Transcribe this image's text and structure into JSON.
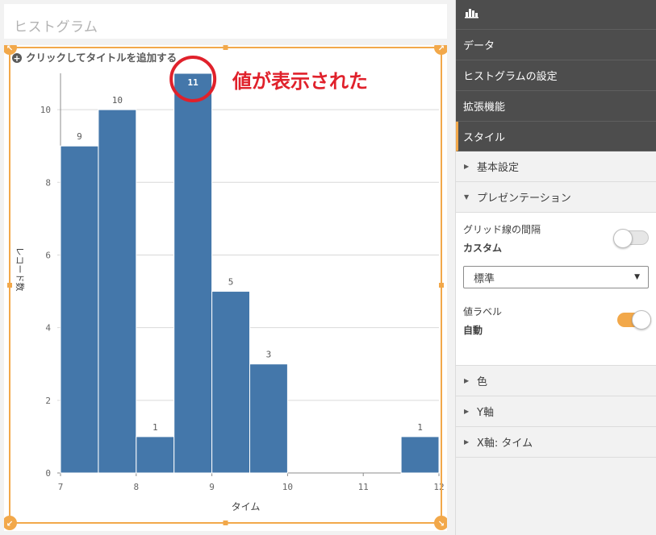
{
  "sheet": {
    "title": "ヒストグラム"
  },
  "chart": {
    "add_title_text": "クリックしてタイトルを追加する"
  },
  "annotation": {
    "text": "値が表示された",
    "color": "#e0212b"
  },
  "chart_data": {
    "type": "bar",
    "xlabel": "タイム",
    "ylabel": "レコード数",
    "bins": [
      {
        "x0": 7.0,
        "x1": 7.5,
        "value": 9
      },
      {
        "x0": 7.5,
        "x1": 8.0,
        "value": 10
      },
      {
        "x0": 8.0,
        "x1": 8.5,
        "value": 1
      },
      {
        "x0": 8.5,
        "x1": 9.0,
        "value": 11
      },
      {
        "x0": 9.0,
        "x1": 9.5,
        "value": 5
      },
      {
        "x0": 9.5,
        "x1": 10.0,
        "value": 3
      },
      {
        "x0": 10.0,
        "x1": 10.5,
        "value": 0
      },
      {
        "x0": 10.5,
        "x1": 11.0,
        "value": 0
      },
      {
        "x0": 11.0,
        "x1": 11.5,
        "value": 0
      },
      {
        "x0": 11.5,
        "x1": 12.0,
        "value": 1
      }
    ],
    "xlim": [
      7,
      12
    ],
    "ylim": [
      0,
      11
    ],
    "x_ticks": [
      "7",
      "8",
      "9",
      "10",
      "11",
      "12"
    ],
    "y_ticks": [
      "0",
      "2",
      "4",
      "6",
      "8",
      "10"
    ],
    "grid": true,
    "bar_color": "#4477aa",
    "highlighted_bin": 3
  },
  "panel": {
    "tabs": [
      {
        "label": "データ"
      },
      {
        "label": "ヒストグラムの設定"
      },
      {
        "label": "拡張機能"
      },
      {
        "label": "スタイル"
      }
    ],
    "sections": {
      "basic": "基本設定",
      "presentation": "プレゼンテーション",
      "color": "色",
      "y_axis": "Y軸",
      "x_axis": "X軸: タイム"
    },
    "grid_spacing": {
      "label": "グリッド線の間隔",
      "value": "カスタム",
      "toggle_on": false
    },
    "grid_select": {
      "value": "標準"
    },
    "value_labels": {
      "label": "値ラベル",
      "value": "自動",
      "toggle_on": true
    },
    "accent": "#f2a84a"
  }
}
